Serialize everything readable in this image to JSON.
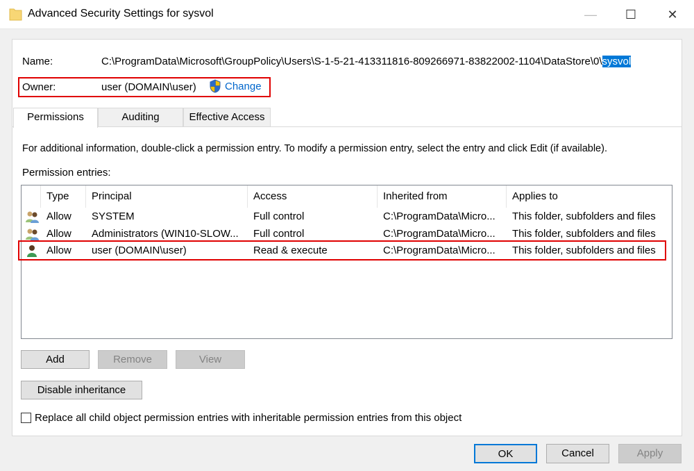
{
  "window": {
    "title": "Advanced Security Settings for sysvol",
    "minimize": "—",
    "maximize": "☐",
    "close": "✕"
  },
  "name": {
    "label": "Name:",
    "path_prefix": "C:\\ProgramData\\Microsoft\\GroupPolicy\\Users\\S-1-5-21-413311816-809266971-83822002-1104\\DataStore\\0\\",
    "path_selected": "sysvol"
  },
  "owner": {
    "label": "Owner:",
    "value": "user (DOMAIN\\user)",
    "change": "Change"
  },
  "tabs": [
    {
      "label": "Permissions"
    },
    {
      "label": "Auditing"
    },
    {
      "label": "Effective Access"
    }
  ],
  "info": "For additional information, double-click a permission entry. To modify a permission entry, select the entry and click Edit (if available).",
  "entries_label": "Permission entries:",
  "columns": [
    "Type",
    "Principal",
    "Access",
    "Inherited from",
    "Applies to"
  ],
  "rows": [
    {
      "icon": "group-icon",
      "type": "Allow",
      "principal": "SYSTEM",
      "access": "Full control",
      "inherited": "C:\\ProgramData\\Micro...",
      "applies": "This folder, subfolders and files"
    },
    {
      "icon": "group-icon",
      "type": "Allow",
      "principal": "Administrators (WIN10-SLOW...",
      "access": "Full control",
      "inherited": "C:\\ProgramData\\Micro...",
      "applies": "This folder, subfolders and files"
    },
    {
      "icon": "user-icon",
      "type": "Allow",
      "principal": "user (DOMAIN\\user)",
      "access": "Read & execute",
      "inherited": "C:\\ProgramData\\Micro...",
      "applies": "This folder, subfolders and files"
    }
  ],
  "buttons": {
    "add": "Add",
    "remove": "Remove",
    "view": "View",
    "disable_inheritance": "Disable inheritance",
    "ok": "OK",
    "cancel": "Cancel",
    "apply": "Apply"
  },
  "replace_checkbox": {
    "label": "Replace all child object permission entries with inheritable permission entries from this object",
    "checked": false
  },
  "colors": {
    "highlight": "#e00000",
    "selection": "#0078d7",
    "link": "#0066cc"
  }
}
